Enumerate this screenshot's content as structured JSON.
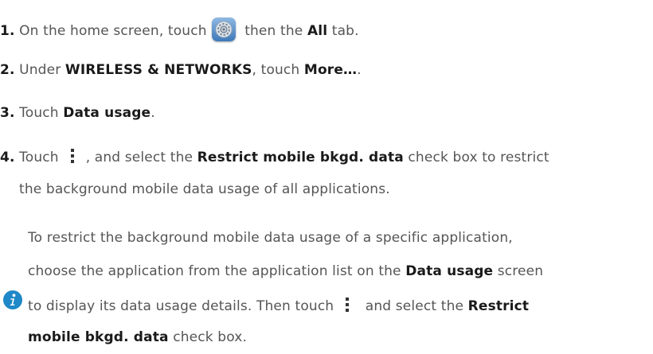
{
  "steps": [
    {
      "number": "1.",
      "t1": " On the home screen, touch",
      "icon": "settings-gear-icon",
      "t2": " then the ",
      "b1": "All",
      "t3": " tab."
    },
    {
      "number": "2.",
      "t1": " Under ",
      "b1": "WIRELESS & NETWORKS",
      "t2": ", touch ",
      "b2": "More…",
      "t3": "."
    },
    {
      "number": "3.",
      "t1": " Touch ",
      "b1": "Data usage",
      "t2": "."
    },
    {
      "number": "4.",
      "t1": " Touch",
      "icon": "menu-kebab-icon",
      "t2": ", and select the ",
      "b1": "Restrict mobile bkgd. data",
      "t3": " check box to restrict",
      "line2": "the background mobile data usage of all applications."
    }
  ],
  "note": {
    "icon": "info-icon",
    "line1": "To restrict the background mobile data usage of a specific application,",
    "line2_t1": "choose the application from the application list on the ",
    "line2_b1": "Data usage",
    "line2_t2": " screen",
    "line3_t1": "to display its data usage details. Then touch",
    "line3_icon": "menu-kebab-icon",
    "line3_t2": " and select the ",
    "line3_b1": "Restrict",
    "line4_b1": "mobile bkgd. data",
    "line4_t1": " check box."
  },
  "colors": {
    "text": "#555555",
    "bold_text": "#1a1a1a",
    "info_icon": "#1e88c8",
    "settings_icon": "#3e78b9"
  }
}
